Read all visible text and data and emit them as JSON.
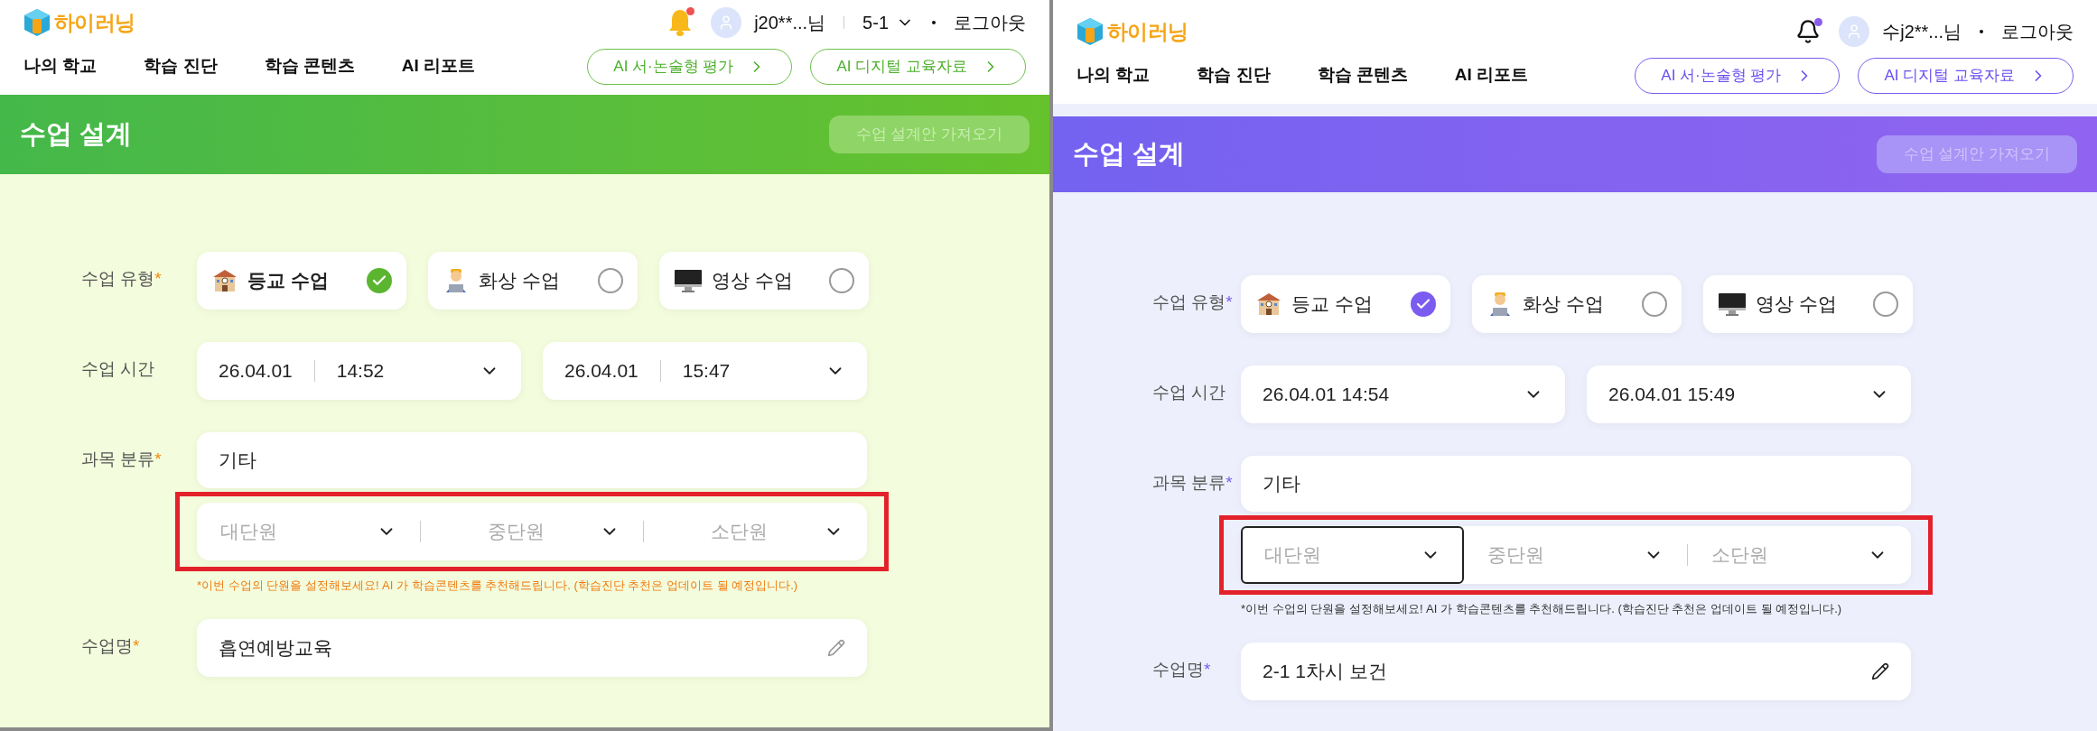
{
  "panels": [
    {
      "kind": "green",
      "logo": "하이러닝",
      "notification_dot": true,
      "user": "j20**...님",
      "class_select": "5-1",
      "logout": "로그아웃",
      "nav": [
        "나의 학교",
        "학습 진단",
        "학습 콘텐츠",
        "AI 리포트"
      ],
      "nav_buttons": [
        "AI 서·논술형 평가",
        "AI 디지털 교육자료"
      ],
      "banner": {
        "title": "수업 설계",
        "button": "수업 설계안 가져오기",
        "button_disabled": true
      },
      "form": {
        "type_label": {
          "text": "수업 유형",
          "mark": "*"
        },
        "types": [
          {
            "kind": "school",
            "label": "등교 수업",
            "selected": true
          },
          {
            "kind": "laptop-person",
            "label": "화상 수업",
            "selected": false
          },
          {
            "kind": "monitor",
            "label": "영상 수업",
            "selected": false
          }
        ],
        "time_label": {
          "text": "수업 시간"
        },
        "times": [
          {
            "date": "26.04.01",
            "time": "14:52"
          },
          {
            "date": "26.04.01",
            "time": "15:47"
          }
        ],
        "subject_label": {
          "text": "과목 분류",
          "mark": "*"
        },
        "subject": "기타",
        "units": [
          {
            "placeholder": "대단원",
            "focused": false
          },
          {
            "placeholder": "중단원",
            "focused": false
          },
          {
            "placeholder": "소단원",
            "focused": false
          }
        ],
        "units_highlighted": true,
        "hint": "*이번 수업의 단원을 설정해보세요! AI 가 학습콘텐츠를 추천해드립니다. (학습진단 추천은 업데이트 될 예정입니다.)",
        "name_label": {
          "text": "수업명",
          "mark": "*"
        },
        "name": "흡연예방교육"
      }
    },
    {
      "kind": "purple",
      "logo": "하이러닝",
      "notification_dot": true,
      "user": "수j2**...님",
      "logout": "로그아웃",
      "nav": [
        "나의 학교",
        "학습 진단",
        "학습 콘텐츠",
        "AI 리포트"
      ],
      "nav_buttons": [
        "AI 서·논술형 평가",
        "AI 디지털 교육자료"
      ],
      "banner": {
        "title": "수업 설계",
        "button": "수업 설계안 가져오기",
        "button_disabled": true
      },
      "form": {
        "type_label": {
          "text": "수업 유형",
          "mark": "*"
        },
        "types": [
          {
            "kind": "school",
            "label": "등교 수업",
            "selected": true
          },
          {
            "kind": "laptop-person",
            "label": "화상 수업",
            "selected": false
          },
          {
            "kind": "monitor",
            "label": "영상 수업",
            "selected": false
          }
        ],
        "time_label": {
          "text": "수업 시간"
        },
        "times": [
          {
            "value": "26.04.01 14:54"
          },
          {
            "value": "26.04.01 15:49"
          }
        ],
        "subject_label": {
          "text": "과목 분류",
          "mark": "*"
        },
        "subject": "기타",
        "units": [
          {
            "placeholder": "대단원",
            "focused": true
          },
          {
            "placeholder": "중단원",
            "focused": false
          },
          {
            "placeholder": "소단원",
            "focused": false
          }
        ],
        "units_highlighted": true,
        "hint": "*이번 수업의 단원을 설정해보세요! AI 가 학습콘텐츠를 추천해드립니다. (학습진단 추천은 업데이트 될 예정입니다.)",
        "name_label": {
          "text": "수업명",
          "mark": "*"
        },
        "name": "2-1 1차시 보건"
      }
    }
  ]
}
